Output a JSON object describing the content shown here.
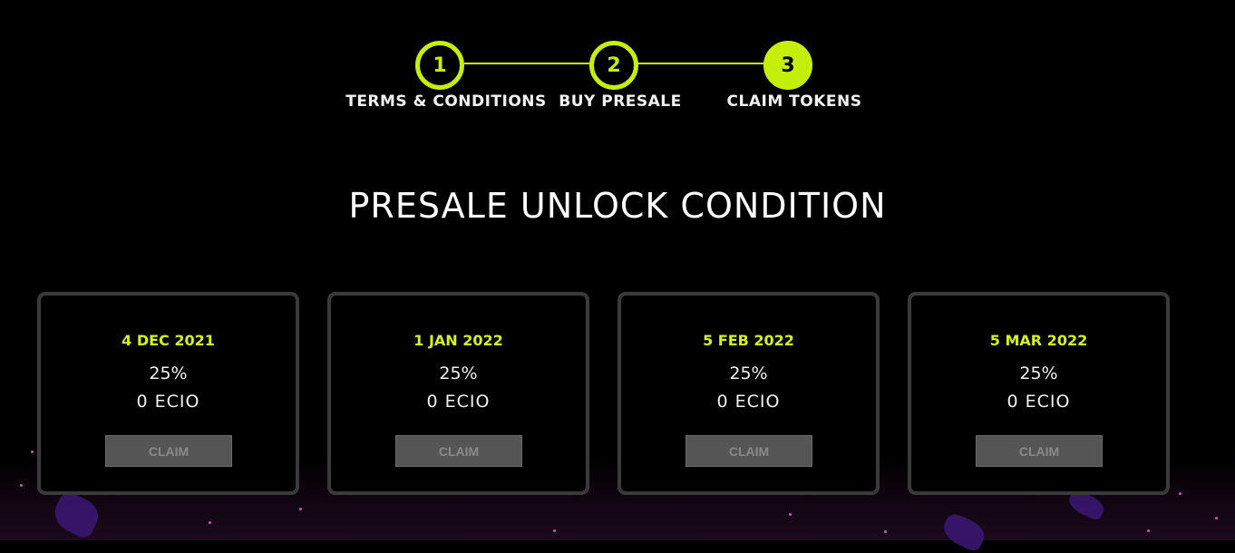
{
  "colors": {
    "accent": "#c5ee0b",
    "date_text": "#d4f21b",
    "background": "#000000",
    "card_border": "#3a3a3a",
    "button_disabled_bg": "#555555",
    "button_disabled_text": "#8a8a8a"
  },
  "stepper": {
    "steps": [
      {
        "number": "1",
        "label": "TERMS & CONDITIONS",
        "active": false
      },
      {
        "number": "2",
        "label": "BUY PRESALE",
        "active": false
      },
      {
        "number": "3",
        "label": "CLAIM TOKENS",
        "active": true
      }
    ]
  },
  "title": "PRESALE UNLOCK CONDITION",
  "cards": [
    {
      "date": "4 DEC 2021",
      "percent": "25%",
      "amount": "0 ECIO",
      "button_label": "CLAIM"
    },
    {
      "date": "1 JAN 2022",
      "percent": "25%",
      "amount": "0 ECIO",
      "button_label": "CLAIM"
    },
    {
      "date": "5 FEB 2022",
      "percent": "25%",
      "amount": "0 ECIO",
      "button_label": "CLAIM"
    },
    {
      "date": "5 MAR 2022",
      "percent": "25%",
      "amount": "0 ECIO",
      "button_label": "CLAIM"
    }
  ]
}
